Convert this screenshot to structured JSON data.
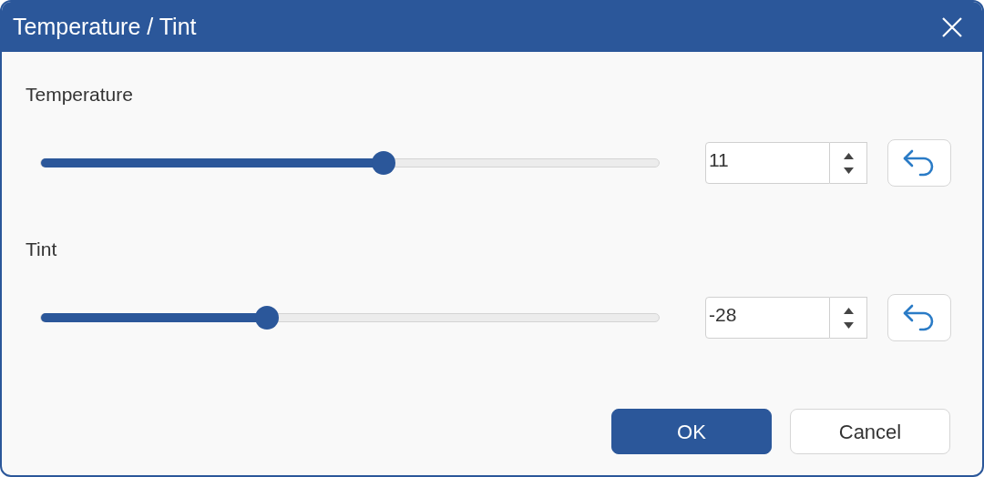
{
  "window": {
    "title": "Temperature / Tint"
  },
  "sliders": [
    {
      "label": "Temperature",
      "level": 0.554,
      "value": "11"
    },
    {
      "label": "Tint",
      "level": 0.366,
      "value": "-28"
    }
  ],
  "buttons": [
    {
      "label": "OK",
      "kind": "primary"
    },
    {
      "label": "Cancel",
      "kind": "secondary"
    }
  ]
}
